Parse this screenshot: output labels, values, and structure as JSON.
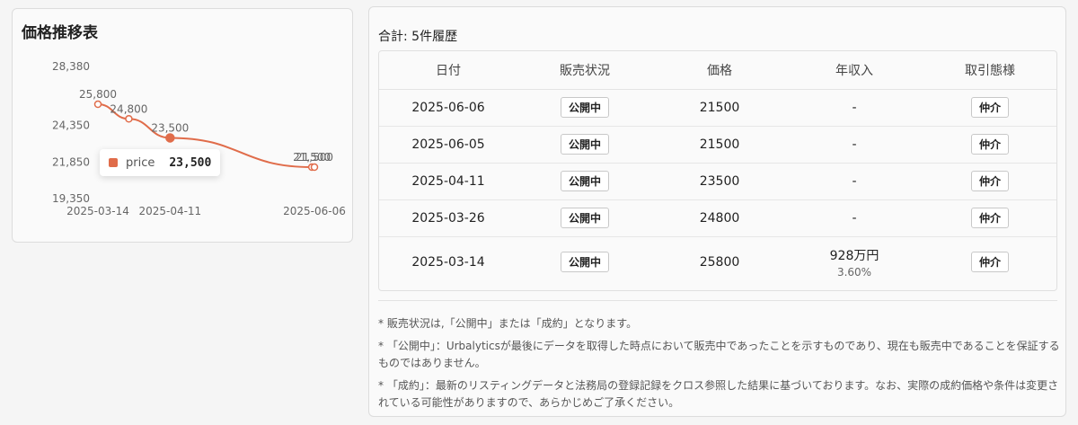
{
  "left_panel": {
    "title": "価格推移表",
    "tooltip": {
      "label": "price",
      "value": "23,500",
      "color": "#e06c4a"
    }
  },
  "chart_data": {
    "type": "line",
    "x": [
      "2025-03-14",
      "2025-03-26",
      "2025-04-11",
      "2025-06-05",
      "2025-06-06"
    ],
    "values": [
      25800,
      24800,
      23500,
      21500,
      21500
    ],
    "value_labels": [
      "25,800",
      "24,800",
      "23,500",
      "21,500",
      "21,500"
    ],
    "y_ticks": [
      "28,380",
      "24,350",
      "21,850",
      "19,350"
    ],
    "x_ticks": [
      "2025-03-14",
      "2025-04-11",
      "2025-06-06"
    ],
    "ylim": [
      19350,
      28380
    ],
    "color": "#e06c4a",
    "active_index": 2
  },
  "right_panel": {
    "total_label": "合計: 5件履歴",
    "columns": [
      "日付",
      "販売状況",
      "価格",
      "年収入",
      "取引態様"
    ],
    "rows": [
      {
        "date": "2025-06-06",
        "status": "公開中",
        "price": "21500",
        "income": "-",
        "income_sub": "",
        "type": "仲介"
      },
      {
        "date": "2025-06-05",
        "status": "公開中",
        "price": "21500",
        "income": "-",
        "income_sub": "",
        "type": "仲介"
      },
      {
        "date": "2025-04-11",
        "status": "公開中",
        "price": "23500",
        "income": "-",
        "income_sub": "",
        "type": "仲介"
      },
      {
        "date": "2025-03-26",
        "status": "公開中",
        "price": "24800",
        "income": "-",
        "income_sub": "",
        "type": "仲介"
      },
      {
        "date": "2025-03-14",
        "status": "公開中",
        "price": "25800",
        "income": "928万円",
        "income_sub": "3.60%",
        "type": "仲介"
      }
    ],
    "notes": [
      "* 販売状況は,「公開中」または「成約」となります。",
      "* 「公開中」：Urbalyticsが最後にデータを取得した時点において販売中であったことを示すものであり、現在も販売中であることを保証するものではありません。",
      "* 「成約」：最新のリスティングデータと法務局の登録記録をクロス参照した結果に基づいております。なお、実際の成約価格や条件は変更されている可能性がありますので、あらかじめご了承ください。"
    ]
  }
}
